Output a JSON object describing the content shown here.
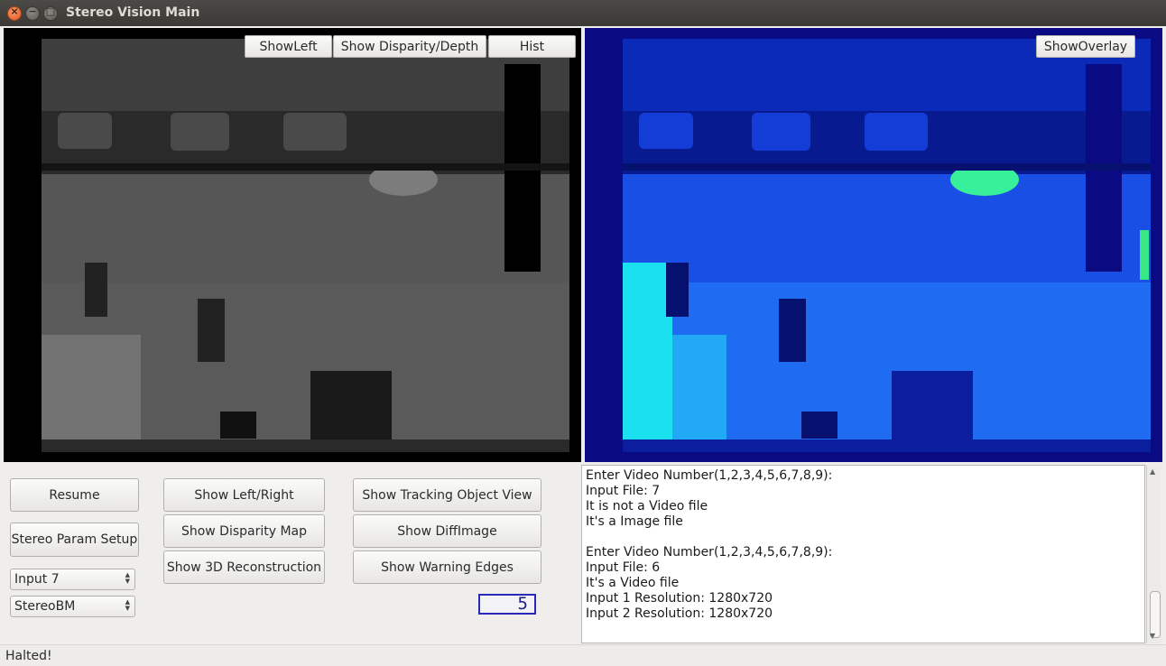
{
  "window": {
    "title": "Stereo Vision Main"
  },
  "left_panel": {
    "show_left": "ShowLeft",
    "show_disparity_depth": "Show Disparity/Depth",
    "hist": "Hist"
  },
  "right_panel": {
    "show_overlay": "ShowOverlay"
  },
  "controls": {
    "resume": "Resume",
    "stereo_param_setup": "Stereo Param Setup",
    "input_select": "Input 7",
    "algo_select": "StereoBM",
    "show_left_right": "Show Left/Right",
    "show_disparity_map": "Show Disparity Map",
    "show_3d_reconstruction": "Show 3D Reconstruction",
    "show_tracking_object_view": "Show Tracking Object View",
    "show_diff_image": "Show DiffImage",
    "show_warning_edges": "Show Warning Edges",
    "lcd_value": "5"
  },
  "console": {
    "lines": [
      "Enter Video Number(1,2,3,4,5,6,7,8,9):",
      "Input File: 7",
      "It is not a Video file",
      "It's a Image file",
      "",
      "Enter Video Number(1,2,3,4,5,6,7,8,9):",
      "Input File: 6",
      "It's a Video file",
      "Input 1 Resolution: 1280x720",
      "Input 2 Resolution: 1280x720"
    ]
  },
  "status": {
    "text": "Halted!"
  }
}
